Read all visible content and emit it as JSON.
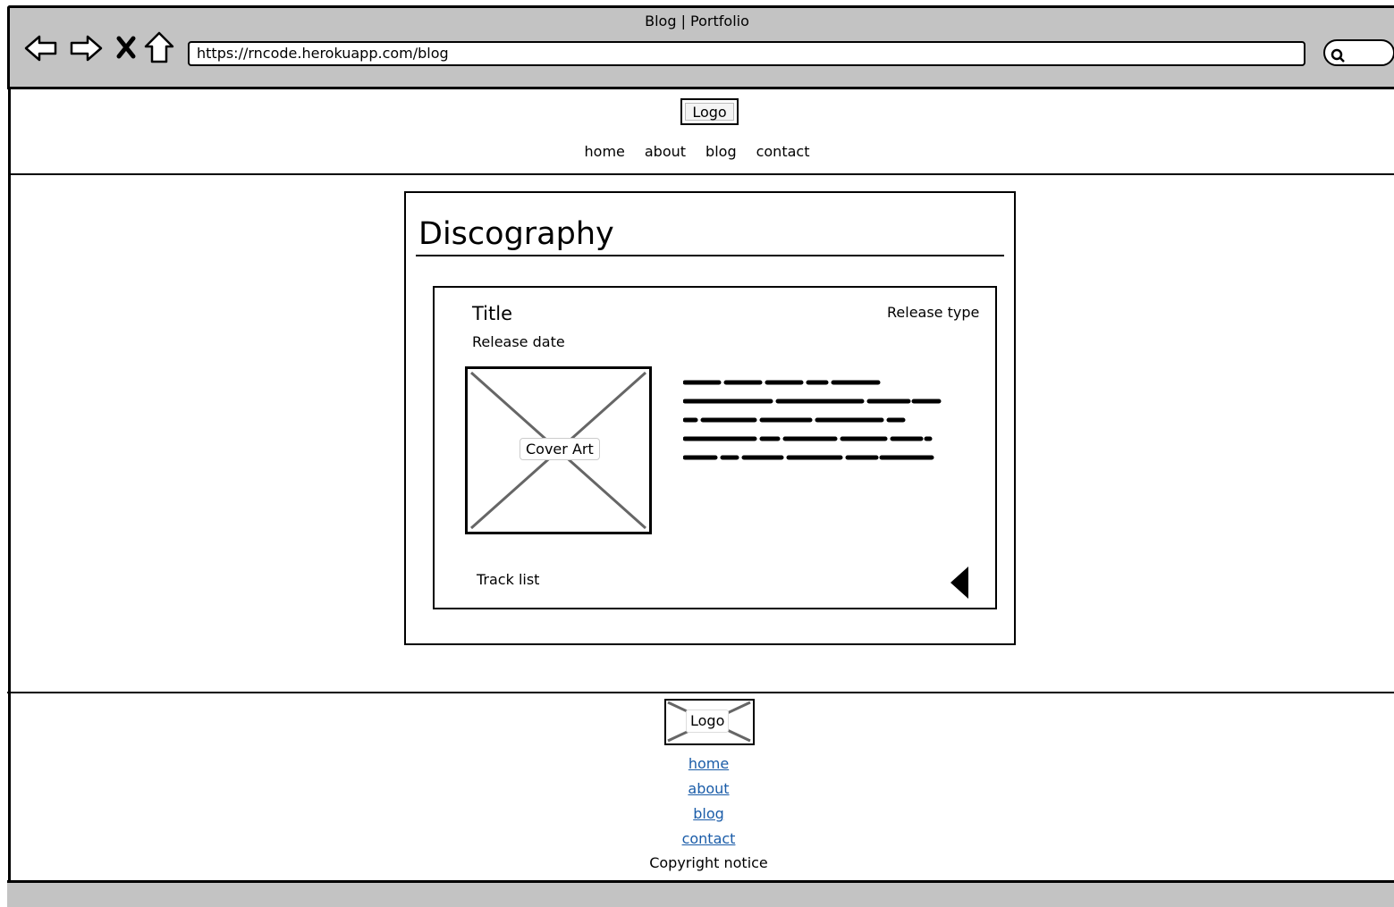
{
  "browser": {
    "title": "Blog | Portfolio",
    "url": "https://rncode.herokuapp.com/blog",
    "nav_icons": [
      "back-icon",
      "forward-icon",
      "stop-icon",
      "home-icon"
    ],
    "search_icon": "search-icon"
  },
  "header": {
    "logo": "Logo",
    "nav": [
      "home",
      "about",
      "blog",
      "contact"
    ]
  },
  "main": {
    "heading": "Discography",
    "release": {
      "title": "Title",
      "release_date": "Release date",
      "release_type": "Release type",
      "cover_art": "Cover Art",
      "track_list": "Track list"
    }
  },
  "footer": {
    "logo": "Logo",
    "links": [
      "home",
      "about",
      "blog",
      "contact"
    ],
    "copyright": "Copyright notice"
  },
  "colors": {
    "chrome": "#c3c3c3",
    "link": "#1a5ca8"
  }
}
